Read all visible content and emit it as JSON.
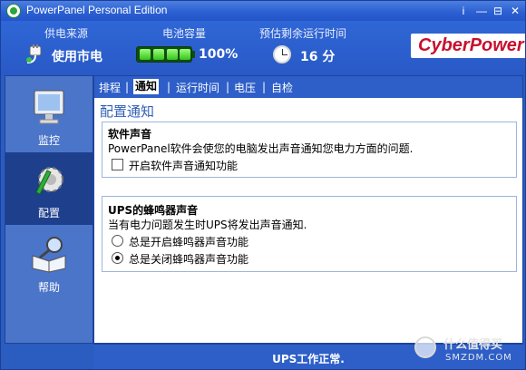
{
  "window": {
    "title": "PowerPanel Personal Edition",
    "info_btn": "i",
    "min_btn": "—",
    "restore_btn": "⊟",
    "close_btn": "✕"
  },
  "header": {
    "power_source_label": "供电来源",
    "power_source_value": "使用市电",
    "battery_label": "电池容量",
    "battery_value": "100%",
    "battery_level": 1.0,
    "runtime_label": "预估剩余运行时间",
    "runtime_value": "16 分",
    "brand": "CyberPower"
  },
  "sidebar": {
    "items": [
      {
        "label": "监控",
        "icon": "monitor-icon"
      },
      {
        "label": "配置",
        "icon": "gear-icon"
      },
      {
        "label": "帮助",
        "icon": "book-magnifier-icon"
      }
    ]
  },
  "tabs": [
    "排程",
    "通知",
    "运行时间",
    "电压",
    "自检"
  ],
  "main": {
    "title": "配置通知",
    "software_sound": {
      "title": "软件声音",
      "desc": "PowerPanel软件会使您的电脑发出声音通知您电力方面的问题.",
      "checkbox_label": "开启软件声音通知功能",
      "checked": false
    },
    "ups_buzzer": {
      "title": "UPS的蜂鸣器声音",
      "desc": "当有电力问题发生时UPS将发出声音通知.",
      "options": [
        "总是开启蜂鸣器声音功能",
        "总是关闭蜂鸣器声音功能"
      ],
      "selected_option": "总是关闭蜂鸣器声音功能"
    }
  },
  "status": {
    "text": "UPS工作正常."
  },
  "watermark": {
    "line1": "什么值得买",
    "line2": "SMZDM.COM"
  },
  "colors": {
    "titlebar": "#2a5ed2",
    "sidebar_selected": "#1d3f8c",
    "brand_red": "#c8102e",
    "heading_blue": "#2f5fb6"
  }
}
